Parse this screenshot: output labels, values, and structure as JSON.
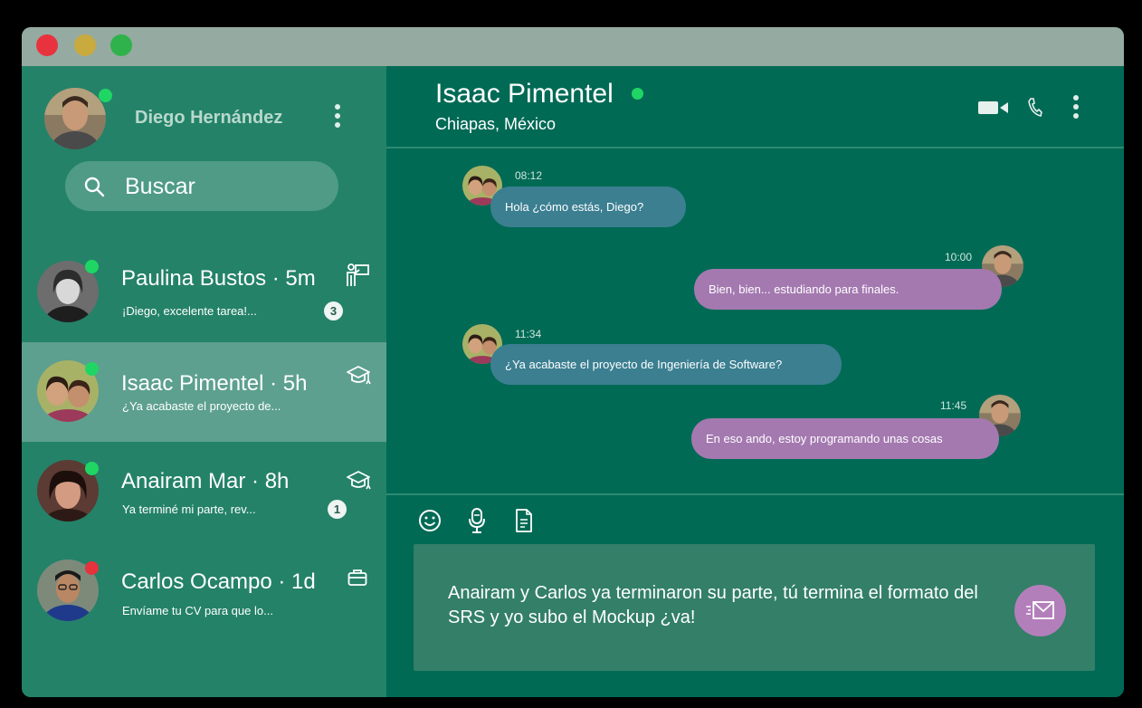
{
  "colors": {
    "sidebar_bg": "#248268",
    "main_bg": "#006a55",
    "incoming_bubble": "#3b7f91",
    "outgoing_bubble": "#a479b0",
    "online": "#1fd665",
    "busy": "#e4333d"
  },
  "window": {
    "controls": [
      "close",
      "minimize",
      "maximize"
    ]
  },
  "me": {
    "name": "Diego Hernández",
    "status": "online"
  },
  "search": {
    "label": "Buscar",
    "icon": "search-icon"
  },
  "chats": [
    {
      "name": "Paulina  Bustos · 5m",
      "preview": "¡Diego, excelente tarea!...",
      "unread": "3",
      "icon": "teacher-icon",
      "status": "online"
    },
    {
      "name": "Isaac Pimentel  · 5h",
      "preview": "¿Ya acabaste el proyecto de...",
      "unread": "",
      "icon": "graduation-cap-icon",
      "status": "online",
      "active": true
    },
    {
      "name": "Anairam Mar  ·  8h",
      "preview": "Ya terminé mi parte, rev...",
      "unread": "1",
      "icon": "graduation-cap-icon",
      "status": "online"
    },
    {
      "name": "Carlos Ocampo  · 1d",
      "preview": "Envíame tu CV para que lo...",
      "unread": "",
      "icon": "briefcase-icon",
      "status": "busy"
    }
  ],
  "contact": {
    "name": "Isaac Pimentel",
    "location": "Chiapas, México",
    "status": "online"
  },
  "messages": [
    {
      "from": "contact",
      "time": "08:12",
      "text": "Hola ¿cómo estás, Diego?"
    },
    {
      "from": "me",
      "time": "10:00",
      "text": "Bien, bien... estudiando para finales."
    },
    {
      "from": "contact",
      "time": "11:34",
      "text": "¿Ya acabaste el proyecto de Ingeniería de Software?"
    },
    {
      "from": "me",
      "time": "11:45",
      "text": "En eso ando, estoy programando unas cosas"
    }
  ],
  "composer": {
    "text": "Anairam y Carlos ya terminaron su parte, tú termina el formato del SRS y yo subo el Mockup ¿va!",
    "tools": [
      "emoji-icon",
      "microphone-icon",
      "document-icon"
    ],
    "send_icon": "send-mail-icon"
  }
}
